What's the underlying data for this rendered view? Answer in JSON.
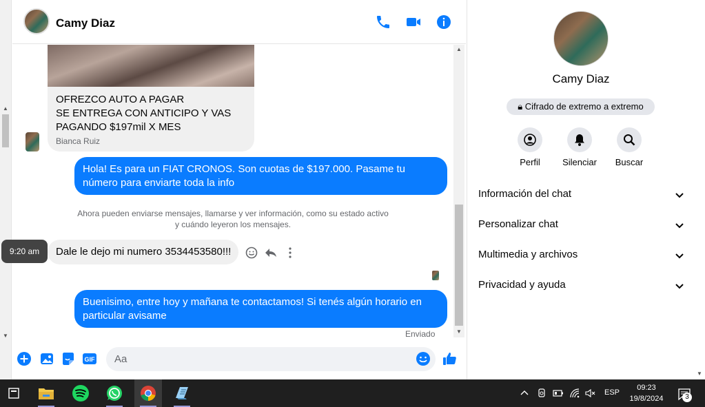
{
  "header": {
    "contact_name": "Camy Diaz",
    "icons": [
      "phone-icon",
      "video-call-icon",
      "info-icon"
    ]
  },
  "messages": {
    "shared_post": {
      "lines": [
        "OFREZCO AUTO A PAGAR",
        "SE ENTREGA CON ANTICIPO Y VAS",
        "PAGANDO $197mil X MES"
      ],
      "author": "Bianca Ruiz"
    },
    "outgoing_1": "Hola! Es para un FIAT CRONOS. Son cuotas de $197.000. Pasame tu número para enviarte toda la info",
    "system_notice": "Ahora pueden enviarse mensajes, llamarse y ver información, como su estado activo y cuándo leyeron los mensajes.",
    "incoming_1": "Dale le dejo mi numero 3534453580!!!",
    "timestamp_tooltip": "9:20 am",
    "outgoing_2": "Buenisimo, entre hoy y mañana te contactamos! Si tenés algún horario en particular avisame",
    "status": "Enviado"
  },
  "composer": {
    "placeholder": "Aa",
    "icons": [
      "plus-icon",
      "image-icon",
      "sticker-icon",
      "gif-icon",
      "emoji-icon",
      "like-icon"
    ],
    "gif_label": "GIF"
  },
  "info_panel": {
    "name": "Camy Diaz",
    "encryption": "Cifrado de extremo a extremo",
    "actions": [
      {
        "label": "Perfil",
        "icon": "profile-icon"
      },
      {
        "label": "Silenciar",
        "icon": "bell-icon"
      },
      {
        "label": "Buscar",
        "icon": "search-icon"
      }
    ],
    "sections": [
      "Información del chat",
      "Personalizar chat",
      "Multimedia y archivos",
      "Privacidad y ayuda"
    ]
  },
  "taskbar": {
    "apps": [
      "task-view-icon",
      "file-explorer-icon",
      "spotify-icon",
      "whatsapp-icon",
      "chrome-icon",
      "notepad-icon"
    ],
    "language": "ESP",
    "time": "09:23",
    "date": "19/8/2024",
    "notification_count": "3"
  },
  "colors": {
    "accent": "#0a7cff",
    "bubble_in": "#f0f0f0",
    "taskbar": "#1f1f1f"
  }
}
